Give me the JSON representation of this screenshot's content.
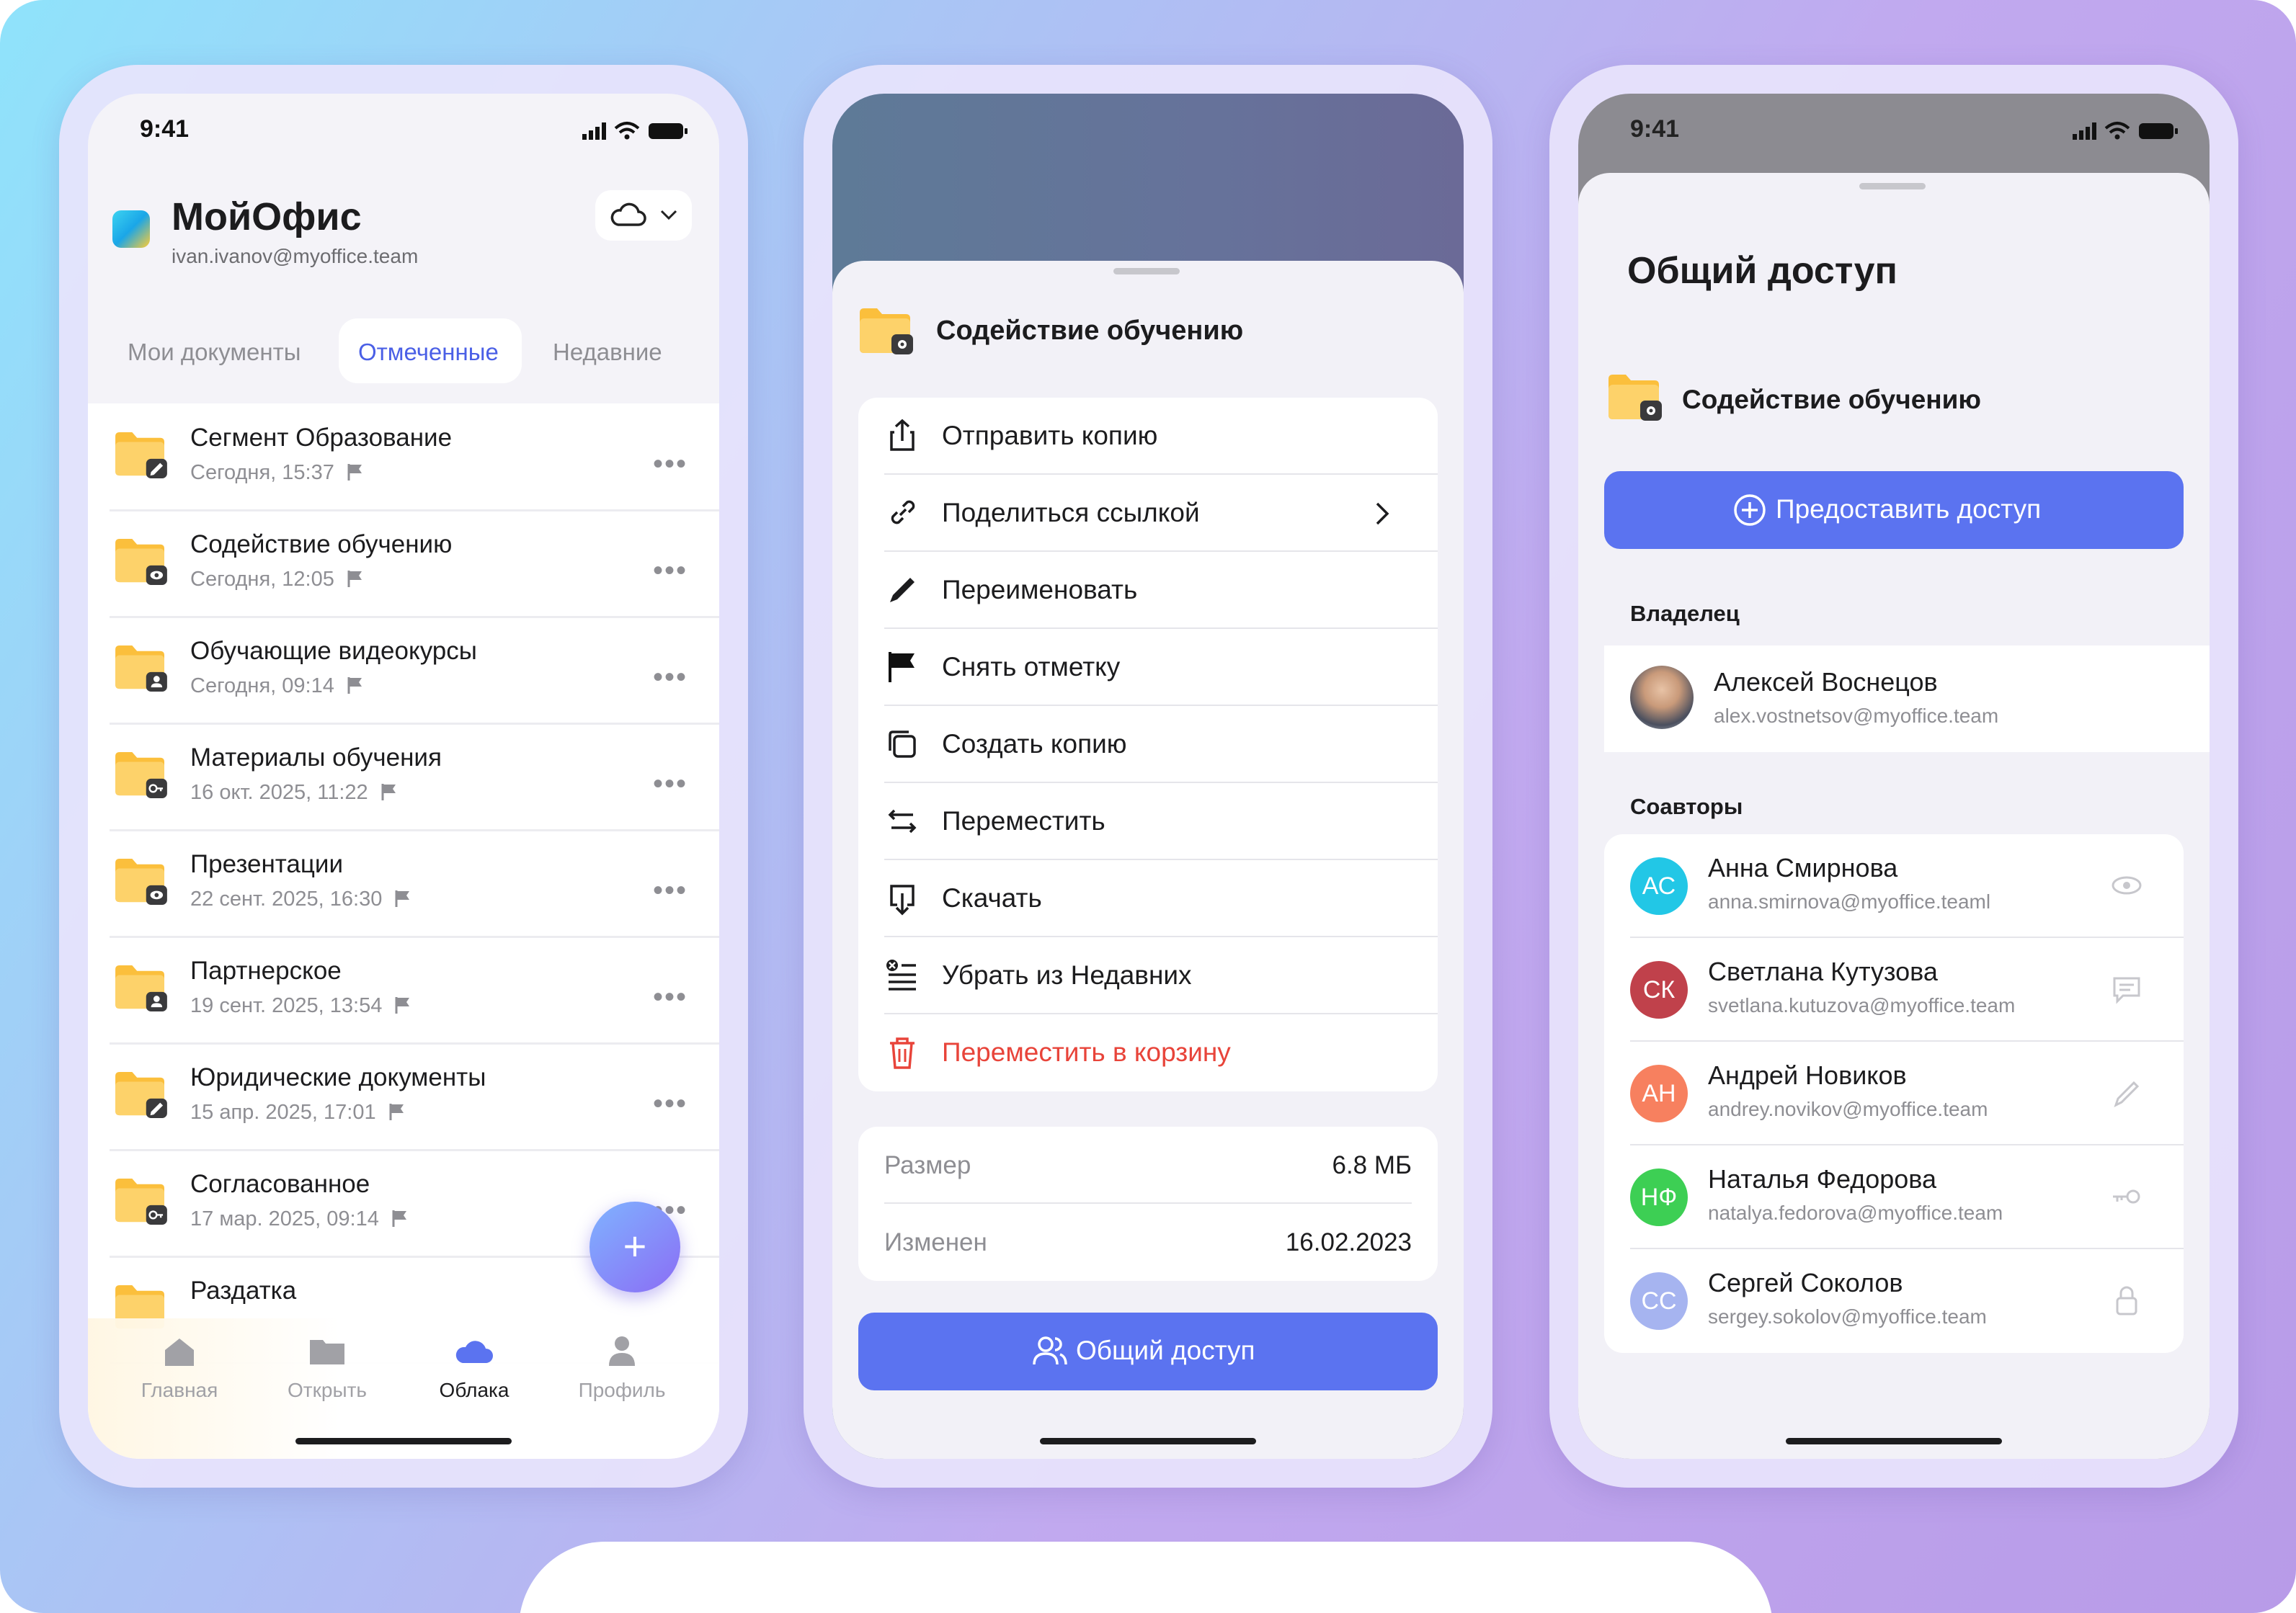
{
  "status_time": "9:41",
  "colors": {
    "accent": "#5b73f0",
    "danger": "#e8443a",
    "folder": "#fbbf3c",
    "sheet_bg": "#f2f1f7"
  },
  "phone1": {
    "app_title": "МойОфис",
    "account_email": "ivan.ivanov@myoffice.team",
    "storage_icon": "cloud-icon",
    "tabs": [
      {
        "label": "Мои документы",
        "active": false
      },
      {
        "label": "Отмеченные",
        "active": true
      },
      {
        "label": "Недавние",
        "active": false
      }
    ],
    "files": [
      {
        "name": "Сегмент Образование",
        "date": "Сегодня, 15:37",
        "badge": "edit-icon"
      },
      {
        "name": "Содействие обучению",
        "date": "Сегодня, 12:05",
        "badge": "eye-icon"
      },
      {
        "name": "Обучающие видеокурсы",
        "date": "Сегодня, 09:14",
        "badge": "person-icon"
      },
      {
        "name": "Материалы обучения",
        "date": "16 окт. 2025, 11:22",
        "badge": "key-icon"
      },
      {
        "name": "Презентации",
        "date": "22 сент. 2025, 16:30",
        "badge": "eye-icon"
      },
      {
        "name": "Партнерское",
        "date": "19 сент. 2025, 13:54",
        "badge": "person-icon"
      },
      {
        "name": "Юридические документы",
        "date": "15 апр. 2025, 17:01",
        "badge": "edit-icon"
      },
      {
        "name": "Согласованное",
        "date": "17 мар. 2025, 09:14",
        "badge": "key-icon"
      },
      {
        "name": "Раздатка",
        "date": "",
        "badge": ""
      }
    ],
    "fab_label": "+",
    "nav": [
      {
        "label": "Главная",
        "icon": "home-icon",
        "active": false
      },
      {
        "label": "Открыть",
        "icon": "folder-icon",
        "active": false
      },
      {
        "label": "Облака",
        "icon": "cloud-icon",
        "active": true
      },
      {
        "label": "Профиль",
        "icon": "user-icon",
        "active": false
      }
    ]
  },
  "phone2": {
    "folder_name": "Содействие обучению",
    "menu": [
      {
        "label": "Отправить копию",
        "icon": "share-icon"
      },
      {
        "label": "Поделиться ссылкой",
        "icon": "link-icon",
        "chevron": true
      },
      {
        "label": "Переименовать",
        "icon": "pencil-icon"
      },
      {
        "label": "Снять отметку",
        "icon": "flag-icon"
      },
      {
        "label": "Создать копию",
        "icon": "copy-icon"
      },
      {
        "label": "Переместить",
        "icon": "move-icon"
      },
      {
        "label": "Скачать",
        "icon": "download-icon"
      },
      {
        "label": "Убрать из Недавних",
        "icon": "remove-recent-icon"
      },
      {
        "label": "Переместить в корзину",
        "icon": "trash-icon",
        "danger": true
      }
    ],
    "info": [
      {
        "key": "Размер",
        "value": "6.8 МБ"
      },
      {
        "key": "Изменен",
        "value": "16.02.2023"
      }
    ],
    "share_button": "Общий доступ"
  },
  "phone3": {
    "title": "Общий доступ",
    "folder_name": "Содействие обучению",
    "grant_button": "Предоставить доступ",
    "owner_heading": "Владелец",
    "owner": {
      "name": "Алексей Воснецов",
      "email": "alex.vostnetsov@myoffice.team"
    },
    "coauthors_heading": "Соавторы",
    "coauthors": [
      {
        "initials": "АС",
        "name": "Анна Смирнова",
        "email": "anna.smirnova@myoffice.teaml",
        "color": "#22c7e6",
        "permission_icon": "eye-icon"
      },
      {
        "initials": "СК",
        "name": "Светлана Кутузова",
        "email": "svetlana.kutuzova@myoffice.team",
        "color": "#c0414b",
        "permission_icon": "comment-icon"
      },
      {
        "initials": "АН",
        "name": "Андрей Новиков",
        "email": "andrey.novikov@myoffice.team",
        "color": "#f7805f",
        "permission_icon": "pencil-icon"
      },
      {
        "initials": "НФ",
        "name": "Наталья Федорова",
        "email": "natalya.fedorova@myoffice.team",
        "color": "#3dcf54",
        "permission_icon": "key-icon"
      },
      {
        "initials": "СС",
        "name": "Сергей Соколов",
        "email": "sergey.sokolov@myoffice.team",
        "color": "#a6b4f0",
        "permission_icon": "lock-icon"
      }
    ]
  }
}
